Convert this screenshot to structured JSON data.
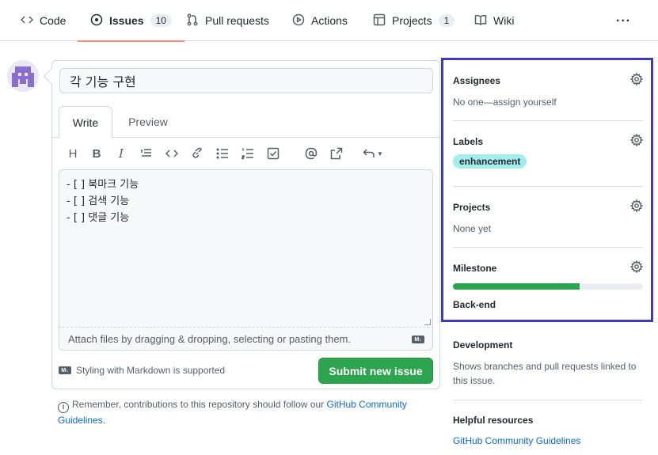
{
  "nav": {
    "tabs": [
      {
        "label": "Code",
        "icon": "code-icon"
      },
      {
        "label": "Issues",
        "icon": "issue-icon",
        "count": "10"
      },
      {
        "label": "Pull requests",
        "icon": "pull-request-icon"
      },
      {
        "label": "Actions",
        "icon": "play-icon"
      },
      {
        "label": "Projects",
        "icon": "table-icon",
        "count": "1"
      },
      {
        "label": "Wiki",
        "icon": "book-icon"
      }
    ],
    "more": "···"
  },
  "form": {
    "title_value": "각 기능 구현",
    "tab_write": "Write",
    "tab_preview": "Preview",
    "body_lines": [
      "- [ ] 북마크 기능",
      "- [ ] 검색 기능",
      "- [ ] 댓글 기능"
    ],
    "attach_text": "Attach files by dragging & dropping, selecting or pasting them.",
    "markdown_note": "Styling with Markdown is supported",
    "submit_label": "Submit new issue",
    "md_badge": "M↓"
  },
  "remember": {
    "text": "Remember, contributions to this repository should follow our",
    "link": "GitHub Community Guidelines",
    "end": "."
  },
  "sidebar": {
    "assignees": {
      "title": "Assignees",
      "value": "No one—assign yourself"
    },
    "labels": {
      "title": "Labels",
      "chip": "enhancement",
      "chip_color": "#a2eeef"
    },
    "projects": {
      "title": "Projects",
      "value": "None yet"
    },
    "milestone": {
      "title": "Milestone",
      "name": "Back-end",
      "progress": 0.667
    },
    "development": {
      "title": "Development",
      "value": "Shows branches and pull requests linked to this issue."
    },
    "helpful": {
      "title": "Helpful resources",
      "link": "GitHub Community Guidelines"
    }
  },
  "colors": {
    "accent_green": "#2da44e",
    "link": "#0969da",
    "highlight_box": "#3b3bbf",
    "tab_underline": "#fd8c73"
  }
}
